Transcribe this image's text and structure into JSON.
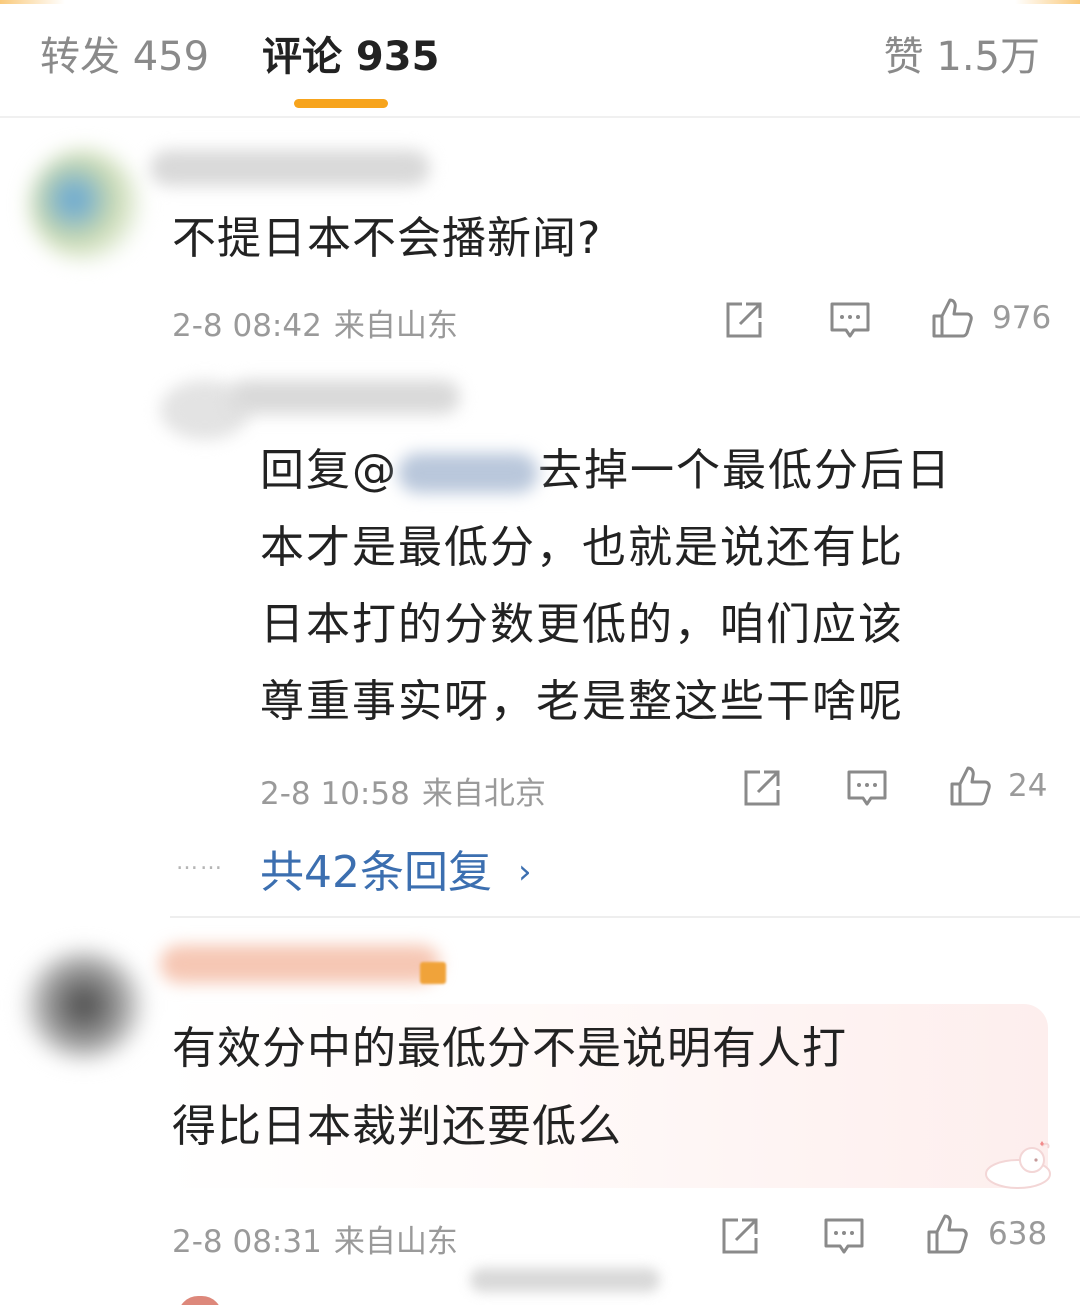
{
  "tabs": {
    "repost": "转发 459",
    "comments": "评论 935",
    "likes": "赞 1.5万"
  },
  "colors": {
    "accent": "#f7a41d",
    "link": "#3c6fb0",
    "meta": "#9a9a9a"
  },
  "comments": [
    {
      "text": "不提日本不会播新闻?",
      "date": "2-8 08:42",
      "location": "来自山东",
      "likes": "976",
      "reply": {
        "line1": "回复@",
        "line1b": "去掉一个最低分后日",
        "line2": "本才是最低分，也就是说还有比",
        "line3": "日本打的分数更低的，咱们应该",
        "line4": "尊重事实呀，老是整这些干啥呢",
        "date": "2-8 10:58",
        "location": "来自北京",
        "likes": "24"
      },
      "more_replies": "共42条回复",
      "more_dots": "……"
    },
    {
      "line1": "有效分中的最低分不是说明有人打",
      "line2": "得比日本裁判还要低么",
      "date": "2-8 08:31",
      "location": "来自山东",
      "likes": "638"
    }
  ],
  "icons": {
    "share": "share-icon",
    "comment": "comment-icon",
    "like": "thumbs-up-icon",
    "more": "chevron-right-icon"
  }
}
